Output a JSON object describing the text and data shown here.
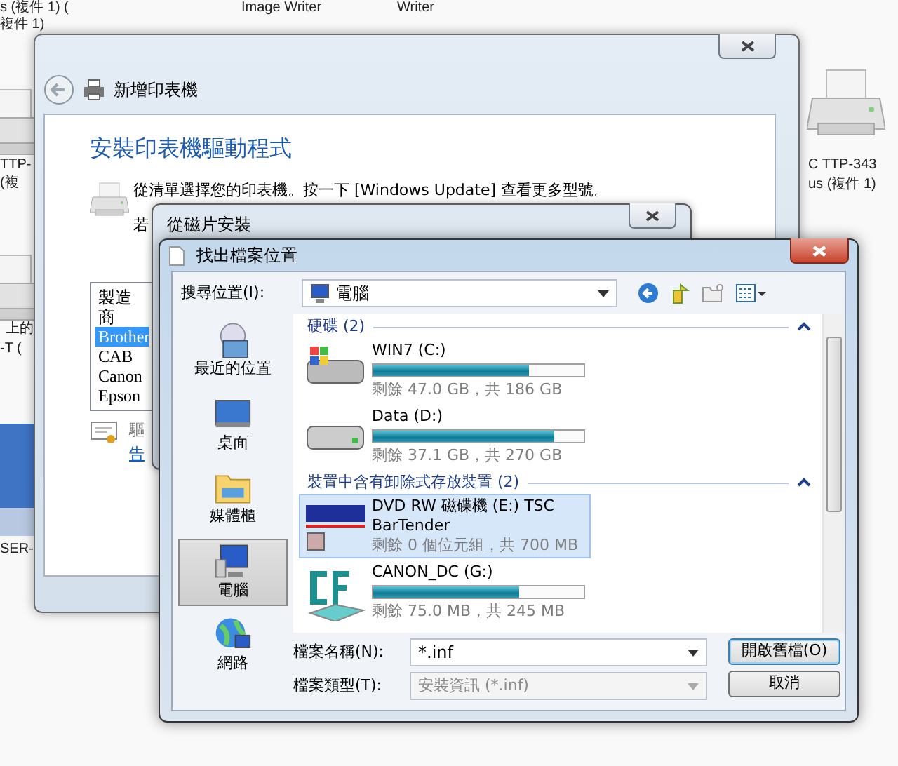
{
  "desktop": {
    "labels": [
      "s (複件 1) (",
      "複件 1)",
      "Image Writer",
      "Writer",
      "TTP-",
      "(複",
      "上的",
      "-T (",
      "SER-",
      "C TTP-343",
      "us (複件 1)"
    ]
  },
  "add_printer_window": {
    "title": "新增印表機",
    "heading": "安裝印表機驅動程式",
    "instruction": "從清單選擇您的印表機。按一下 [Windows Update] 查看更多型號。",
    "instruction_2": "若",
    "manufacturer_list": {
      "header": "製造商",
      "items": [
        {
          "label": "Brother",
          "selected": true
        },
        {
          "label": "CAB",
          "selected": false
        },
        {
          "label": "Canon",
          "selected": false
        },
        {
          "label": "Epson",
          "selected": false
        }
      ]
    },
    "driver_note": "驅",
    "link": "告"
  },
  "disk_install_window": {
    "title": "從磁片安裝"
  },
  "browse_window": {
    "title": "找出檔案位置",
    "look_in_label": "搜尋位置(I):",
    "look_in_value": "電腦",
    "places": [
      {
        "label": "最近的位置",
        "selected": false
      },
      {
        "label": "桌面",
        "selected": false
      },
      {
        "label": "媒體櫃",
        "selected": false
      },
      {
        "label": "電腦",
        "selected": true
      },
      {
        "label": "網路",
        "selected": false
      }
    ],
    "groups": [
      {
        "header": "硬碟 (2)",
        "items": [
          {
            "kind": "system-drive",
            "name": "WIN7 (C:)",
            "level": 0.74,
            "free": "剩餘 47.0 GB，共 186 GB",
            "selected": false
          },
          {
            "kind": "drive",
            "name": "Data (D:)",
            "level": 0.86,
            "free": "剩餘 37.1 GB，共 270 GB",
            "selected": false
          }
        ]
      },
      {
        "header": "裝置中含有卸除式存放裝置 (2)",
        "items": [
          {
            "kind": "optical",
            "name": "DVD RW 磁碟機 (E:) TSC BarTender",
            "free": "剩餘 0 個位元組，共 700 MB",
            "selected": true
          },
          {
            "kind": "card",
            "name": "CANON_DC (G:)",
            "level": 0.69,
            "free": "剩餘 75.0 MB，共 245 MB",
            "selected": false
          }
        ]
      }
    ],
    "file_name_label": "檔案名稱(N):",
    "file_name_value": "*.inf",
    "file_type_label": "檔案類型(T):",
    "file_type_value": "安裝資訊 (*.inf)",
    "file_type_disabled": true,
    "buttons": [
      {
        "label": "開啟舊檔(O)",
        "default": true
      },
      {
        "label": "取消",
        "default": false
      }
    ]
  }
}
